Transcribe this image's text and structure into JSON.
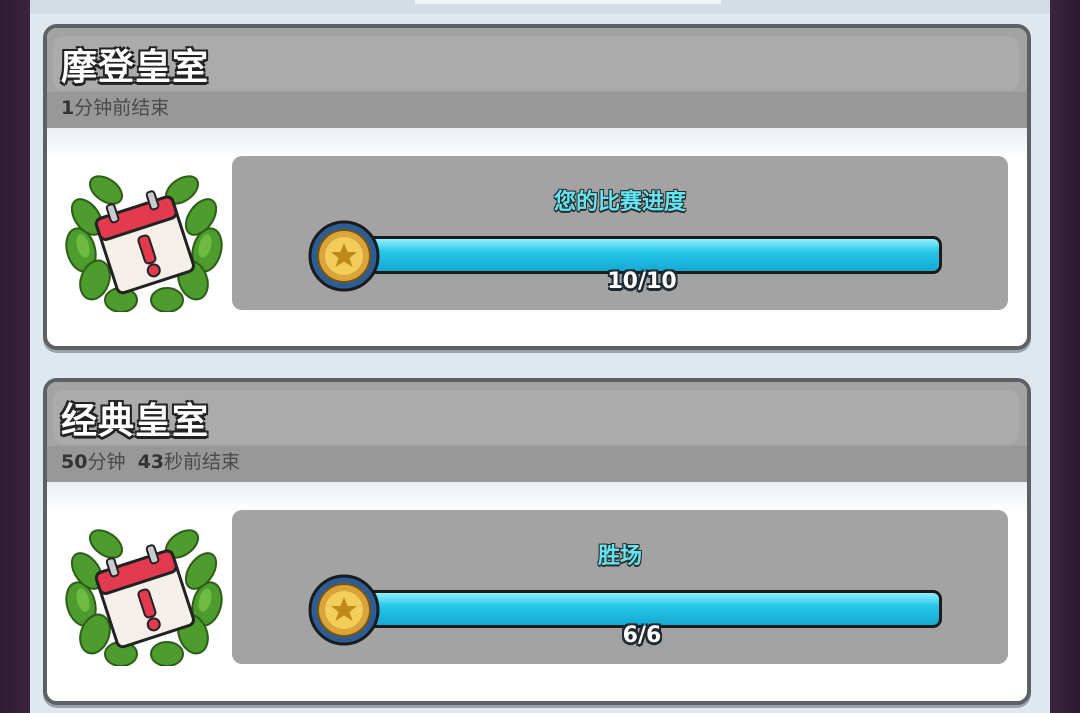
{
  "cards": [
    {
      "title": "摩登皇室",
      "subtitle_prefix": "1",
      "subtitle_rest": "分钟前结束",
      "progress_label": "您的比赛进度",
      "progress_text": "10/10",
      "progress_fraction": 1.0,
      "icon": "calendar-laurel-icon"
    },
    {
      "title": "经典皇室",
      "subtitle_num1": "50",
      "subtitle_unit1": "分钟",
      "subtitle_num2": "43",
      "subtitle_unit2": "秒前结束",
      "progress_label": "胜场",
      "progress_text": "6/6",
      "progress_fraction": 1.0,
      "icon": "calendar-laurel-icon"
    }
  ],
  "colors": {
    "accent_cyan": "#27c7e8",
    "label_cyan": "#62e6f4",
    "header_gray": "#a3a3a3"
  }
}
